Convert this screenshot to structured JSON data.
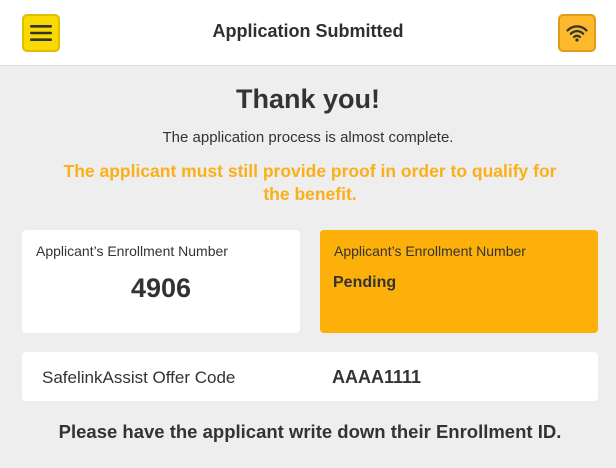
{
  "header": {
    "title": "Application Submitted",
    "menu_icon": "hamburger-menu-icon",
    "wifi_icon": "wifi-icon"
  },
  "main": {
    "heading": "Thank you!",
    "subtitle": "The application process is almost complete.",
    "warning": "The applicant must still provide proof in order to qualify for the benefit.",
    "enrollment_card": {
      "label": "Applicant’s Enrollment Number",
      "value": "4906"
    },
    "enrollment_status_card": {
      "label": "Applicant’s Enrollment Number",
      "value": "Pending"
    },
    "offer": {
      "label": "SafelinkAssist Offer Code",
      "value": "AAAA1111"
    },
    "footer_note": "Please have the applicant write down their Enrollment ID."
  },
  "colors": {
    "accent_yellow": "#fdb00a",
    "warning_text": "#fbaf18",
    "menu_button": "#f8d900",
    "background": "#eeeeee"
  }
}
